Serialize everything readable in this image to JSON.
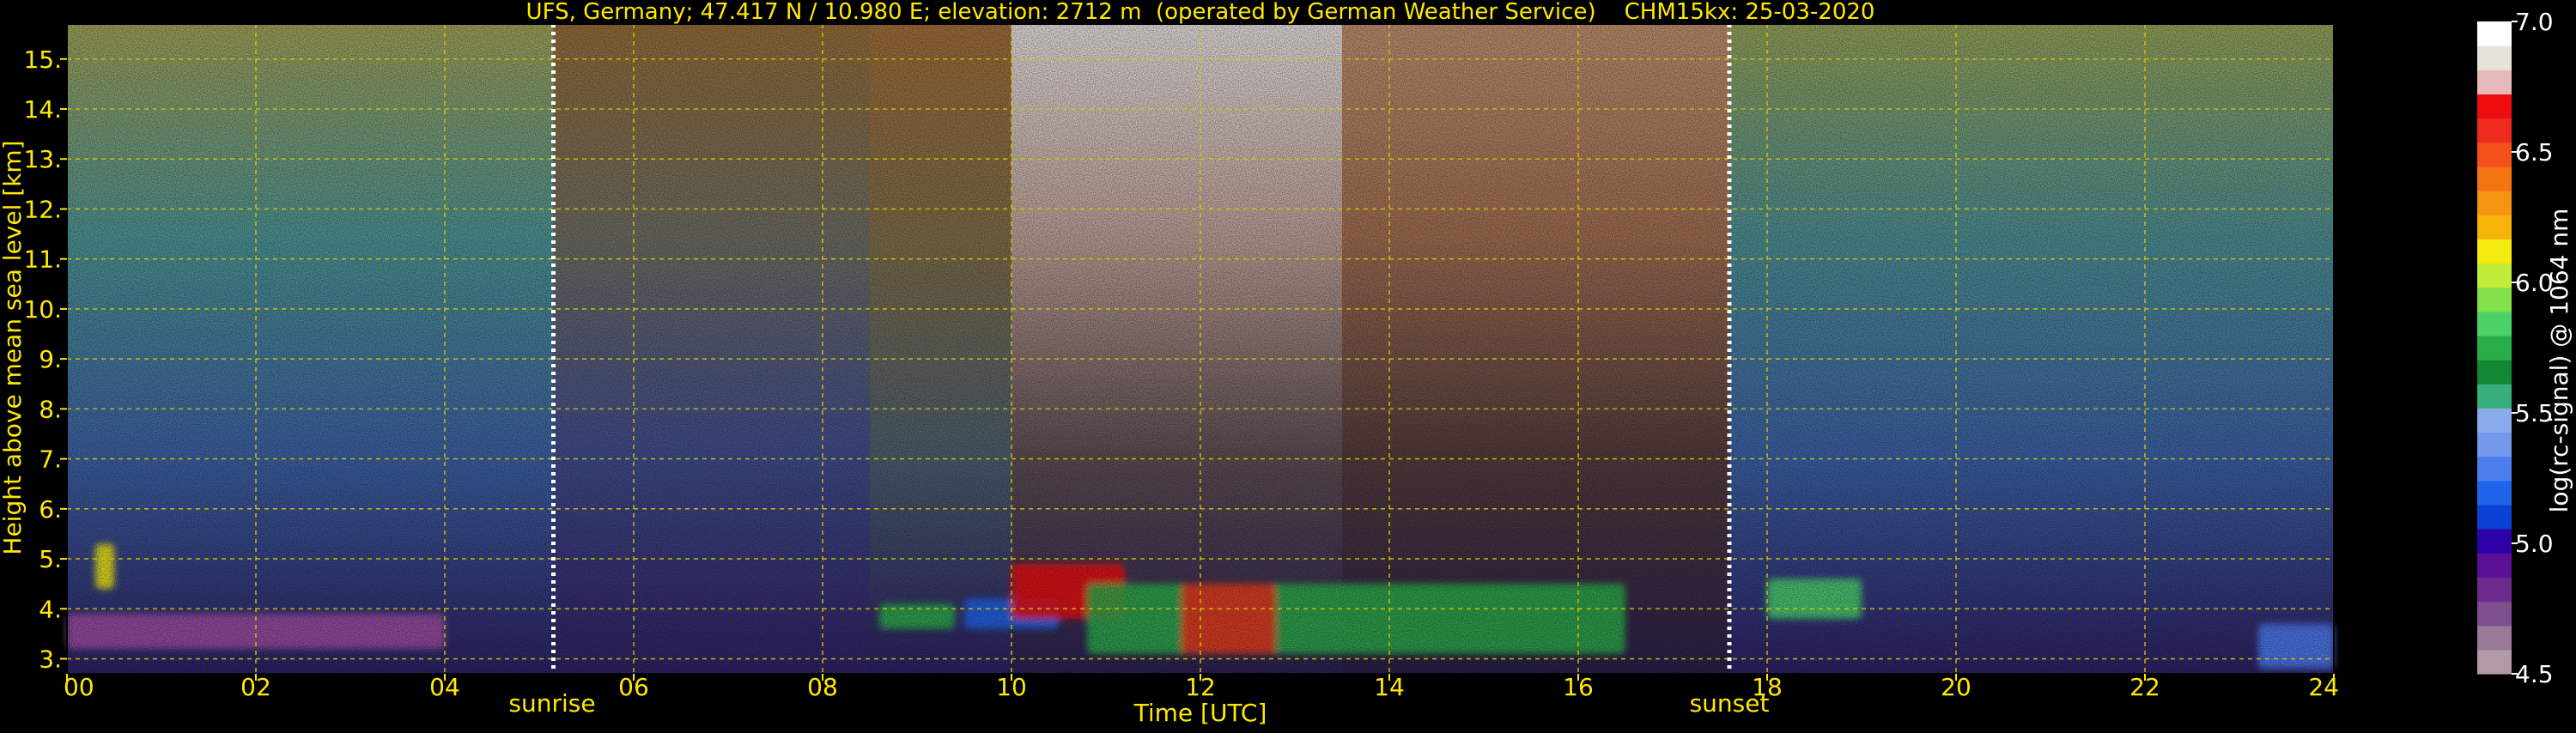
{
  "chart_data": {
    "type": "heatmap",
    "title": "UFS, Germany; 47.417 N / 10.980 E; elevation: 2712 m  (operated by German Weather Service)    CHM15kx: 25-03-2020",
    "xlabel": "Time [UTC]",
    "ylabel": "Height above mean sea level [km]",
    "colorbar_label": "log(rc-signal) @ 1064 nm",
    "xlim": [
      0,
      24
    ],
    "ylim": [
      2.7,
      15.7
    ],
    "x_tick_labels": [
      "00",
      "02",
      "04",
      "06",
      "08",
      "10",
      "12",
      "14",
      "16",
      "18",
      "20",
      "22",
      "24"
    ],
    "y_ticks": [
      3,
      4,
      5,
      6,
      7,
      8,
      9,
      10,
      11,
      12,
      13,
      14,
      15
    ],
    "y_tick_labels": [
      "3.",
      "4.",
      "5.",
      "6.",
      "7.",
      "8.",
      "9.",
      "10.",
      "11.",
      "12.",
      "13.",
      "14.",
      "15."
    ],
    "colorbar_range": [
      4.5,
      7.0
    ],
    "colorbar_tick_values": [
      4.5,
      5.0,
      5.5,
      6.0,
      6.5,
      7.0
    ],
    "colorbar_tick_labels": [
      "4.5",
      "5.0",
      "5.5",
      "6.0",
      "6.5",
      "7.0"
    ],
    "colorbar_colors": [
      "#b09aa6",
      "#9a7898",
      "#7d4f8d",
      "#6b2a8c",
      "#5a1196",
      "#2d00a8",
      "#0c3fd3",
      "#1e64ea",
      "#4d7ef0",
      "#7398ec",
      "#8aabeb",
      "#37ae7d",
      "#138833",
      "#2aae4a",
      "#4bd36a",
      "#82e14a",
      "#c2ec3a",
      "#f5ec0f",
      "#f6b40b",
      "#f59312",
      "#f57412",
      "#f3501b",
      "#ee2a1d",
      "#ed0d0f",
      "#e7b9b9",
      "#e7e2da",
      "#ffffff"
    ],
    "grid": true,
    "sunrise": {
      "x": 5.15,
      "label": "sunrise"
    },
    "sunset": {
      "x": 17.6,
      "label": "sunset"
    },
    "background_signal_bands": [
      {
        "x0": 0,
        "x1": 5.15,
        "colors": [
          "#2b2060",
          "#3b5e9e",
          "#4a8f8f",
          "#9a9c56"
        ]
      },
      {
        "x0": 5.15,
        "x1": 8.5,
        "colors": [
          "#2e2060",
          "#3e4a88",
          "#6a6a60",
          "#8e6a38"
        ]
      },
      {
        "x0": 8.5,
        "x1": 10,
        "colors": [
          "#2a1f60",
          "#4a5c6c",
          "#7a6a48",
          "#9a6a38"
        ]
      },
      {
        "x0": 10,
        "x1": 13.5,
        "colors": [
          "#2a1f50",
          "#5a4b50",
          "#b59a90",
          "#dcd6d4"
        ]
      },
      {
        "x0": 13.5,
        "x1": 17.6,
        "colors": [
          "#281e48",
          "#503a3a",
          "#9a6a50",
          "#b88a6a"
        ]
      },
      {
        "x0": 17.6,
        "x1": 24,
        "colors": [
          "#2b1f60",
          "#3a5ea0",
          "#4a8a90",
          "#8e9c56"
        ]
      }
    ],
    "cloud_features": [
      {
        "x0": 0.3,
        "x1": 0.5,
        "y0": 4.4,
        "y1": 5.3,
        "color": "#f5ec0f"
      },
      {
        "x0": 0,
        "x1": 4.0,
        "y0": 3.2,
        "y1": 3.9,
        "color": "#a04da0"
      },
      {
        "x0": 8.6,
        "x1": 9.4,
        "y0": 3.6,
        "y1": 4.1,
        "color": "#2aae4a"
      },
      {
        "x0": 9.5,
        "x1": 10.5,
        "y0": 3.6,
        "y1": 4.2,
        "color": "#1e64ea"
      },
      {
        "x0": 10.0,
        "x1": 11.2,
        "y0": 3.8,
        "y1": 4.9,
        "color": "#ed0d0f"
      },
      {
        "x0": 10.8,
        "x1": 16.5,
        "y0": 3.1,
        "y1": 4.5,
        "color": "#2aae4a"
      },
      {
        "x0": 11.8,
        "x1": 12.8,
        "y0": 3.1,
        "y1": 4.5,
        "color": "#ee2a1d"
      },
      {
        "x0": 18.0,
        "x1": 19.0,
        "y0": 3.8,
        "y1": 4.6,
        "color": "#4bd36a"
      },
      {
        "x0": 23.2,
        "x1": 24,
        "y0": 2.8,
        "y1": 3.7,
        "color": "#4d7ef0"
      }
    ]
  }
}
